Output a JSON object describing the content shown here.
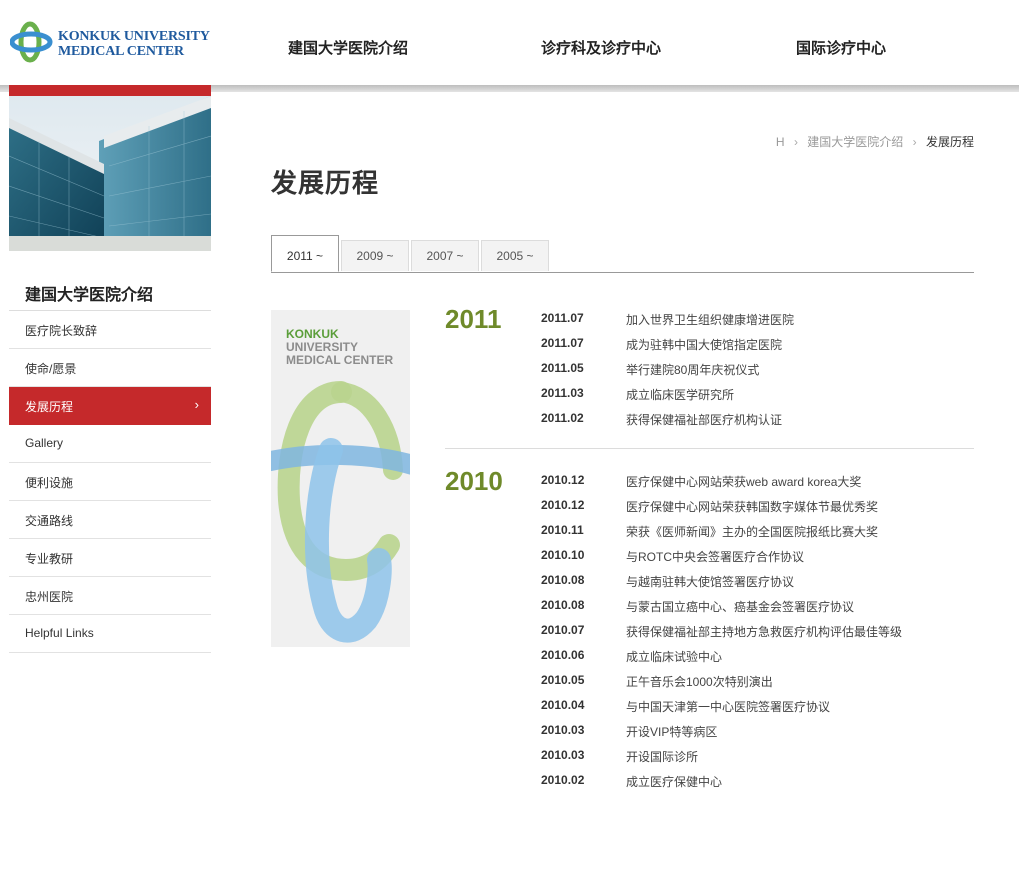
{
  "header": {
    "logo": {
      "line1": "KONKUK UNIVERSITY",
      "line2": "MEDICAL CENTER",
      "colors": {
        "green": "#6ab04c",
        "blue": "#3a8fd0"
      }
    },
    "nav": [
      "建国大学医院介绍",
      "诊疗科及诊疗中心",
      "国际诊疗中心"
    ]
  },
  "sidebar": {
    "title": "建国大学医院介绍",
    "items": [
      {
        "label": "医疗院长致辞"
      },
      {
        "label": "使命/愿景"
      },
      {
        "label": "发展历程",
        "active": true,
        "arrow": "›"
      },
      {
        "label": "Gallery"
      },
      {
        "label": "便利设施"
      },
      {
        "label": "交通路线"
      },
      {
        "label": "专业教研"
      },
      {
        "label": "忠州医院"
      },
      {
        "label": "Helpful Links"
      }
    ],
    "accent": "#c5292b"
  },
  "breadcrumb": {
    "home": "H",
    "sep": "›",
    "parent": "建国大学医院介绍",
    "current": "发展历程"
  },
  "page": {
    "title": "发展历程"
  },
  "tabs": [
    "2011 ~",
    "2009 ~",
    "2007 ~",
    "2005 ~"
  ],
  "banner": {
    "line1": "KONKUK",
    "line2": "UNIVERSITY",
    "line3": "MEDICAL CENTER"
  },
  "timeline": [
    {
      "year": "2011",
      "events": [
        {
          "date": "2011.07",
          "text": "加入世界卫生组织健康增进医院"
        },
        {
          "date": "2011.07",
          "text": "成为驻韩中国大使馆指定医院"
        },
        {
          "date": "2011.05",
          "text": "举行建院80周年庆祝仪式"
        },
        {
          "date": "2011.03",
          "text": "成立临床医学研究所"
        },
        {
          "date": "2011.02",
          "text": "获得保健福祉部医疗机构认证"
        }
      ]
    },
    {
      "year": "2010",
      "events": [
        {
          "date": "2010.12",
          "text": "医疗保健中心网站荣获web award korea大奖"
        },
        {
          "date": "2010.12",
          "text": "医疗保健中心网站荣获韩国数字媒体节最优秀奖"
        },
        {
          "date": "2010.11",
          "text": "荣获《医师新闻》主办的全国医院报纸比赛大奖"
        },
        {
          "date": "2010.10",
          "text": "与ROTC中央会签署医疗合作协议"
        },
        {
          "date": "2010.08",
          "text": "与越南驻韩大使馆签署医疗协议"
        },
        {
          "date": "2010.08",
          "text": "与蒙古国立癌中心、癌基金会签署医疗协议"
        },
        {
          "date": "2010.07",
          "text": "获得保健福祉部主持地方急救医疗机构评估最佳等级"
        },
        {
          "date": "2010.06",
          "text": "成立临床试验中心"
        },
        {
          "date": "2010.05",
          "text": "正午音乐会1000次特别演出"
        },
        {
          "date": "2010.04",
          "text": "与中国天津第一中心医院签署医疗协议"
        },
        {
          "date": "2010.03",
          "text": "开设VIP特等病区"
        },
        {
          "date": "2010.03",
          "text": "开设国际诊所"
        },
        {
          "date": "2010.02",
          "text": "成立医疗保健中心"
        }
      ]
    }
  ],
  "colors": {
    "year": "#6f8a2a"
  }
}
